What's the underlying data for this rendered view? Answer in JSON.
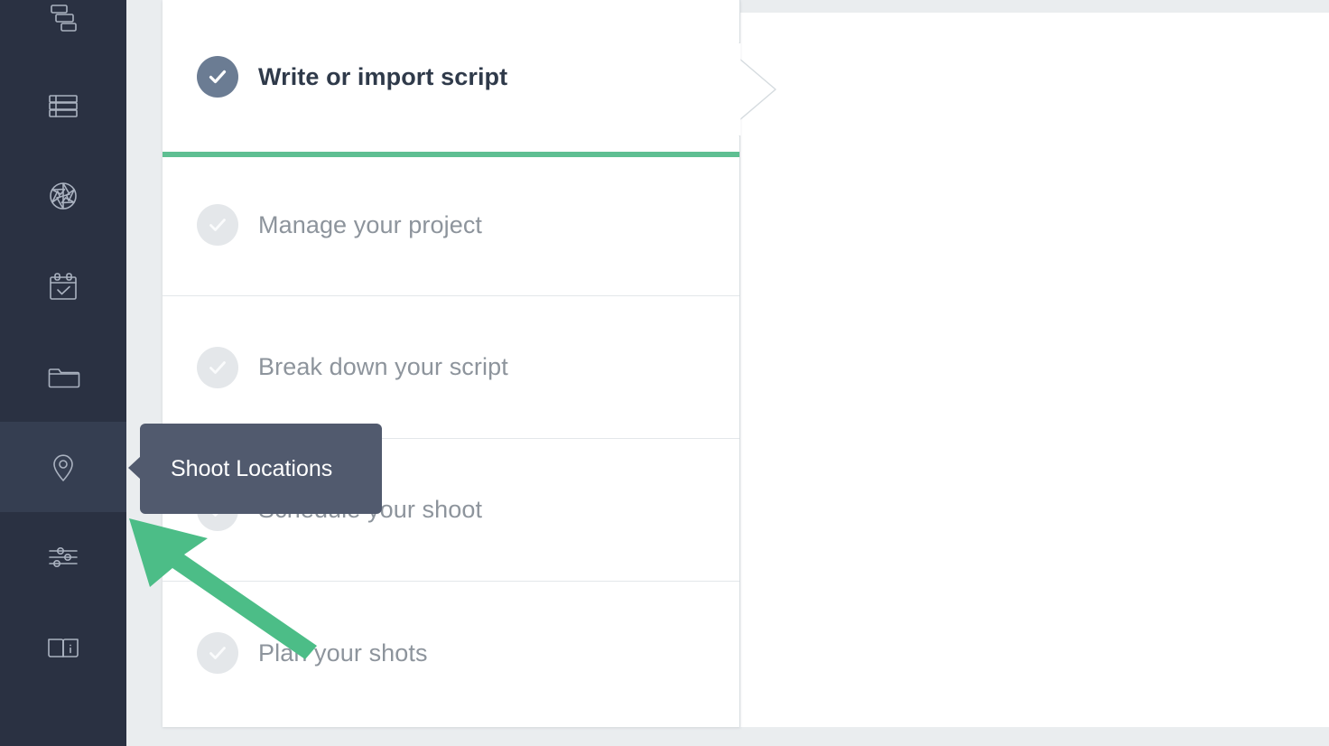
{
  "sidebar": {
    "items": [
      {
        "icon": "gantt-chart-icon",
        "name": "sidebar-item-schedule-board",
        "active": false
      },
      {
        "icon": "stripboard-icon",
        "name": "sidebar-item-stripboard",
        "active": false
      },
      {
        "icon": "camera-aperture-icon",
        "name": "sidebar-item-shots",
        "active": false
      },
      {
        "icon": "calendar-check-icon",
        "name": "sidebar-item-calendar",
        "active": false
      },
      {
        "icon": "folder-icon",
        "name": "sidebar-item-files",
        "active": false
      },
      {
        "icon": "map-pin-icon",
        "name": "sidebar-item-shoot-locations",
        "active": true
      },
      {
        "icon": "sliders-icon",
        "name": "sidebar-item-settings",
        "active": false
      },
      {
        "icon": "open-book-info-icon",
        "name": "sidebar-item-help",
        "active": false
      }
    ]
  },
  "tooltip": {
    "label": "Shoot Locations",
    "background": "#515a6e",
    "text_color": "#ffffff"
  },
  "checklist": {
    "tasks": [
      {
        "label": "Write or import script",
        "state": "active",
        "checked": true
      },
      {
        "label": "Manage your project",
        "state": "pending",
        "checked": true
      },
      {
        "label": "Break down your script",
        "state": "pending",
        "checked": true
      },
      {
        "label": "Schedule your shoot",
        "state": "pending",
        "checked": true
      },
      {
        "label": "Plan your shots",
        "state": "pending",
        "checked": true
      }
    ],
    "active_accent": "#5ebf92"
  },
  "colors": {
    "sidebar_bg": "#2a3142",
    "sidebar_active_bg": "#353e51",
    "page_bg": "#eaedef",
    "panel_bg": "#ffffff",
    "accent_green": "#5ebf92",
    "pointer_green": "#4cbd87",
    "check_done": "#6b7c93",
    "check_todo": "#e4e7ea",
    "text_active": "#2f3a4a",
    "text_muted": "#8d949c"
  },
  "annotation": {
    "pointer": "green-arrow-pointer",
    "points_to": "sidebar-item-shoot-locations"
  }
}
